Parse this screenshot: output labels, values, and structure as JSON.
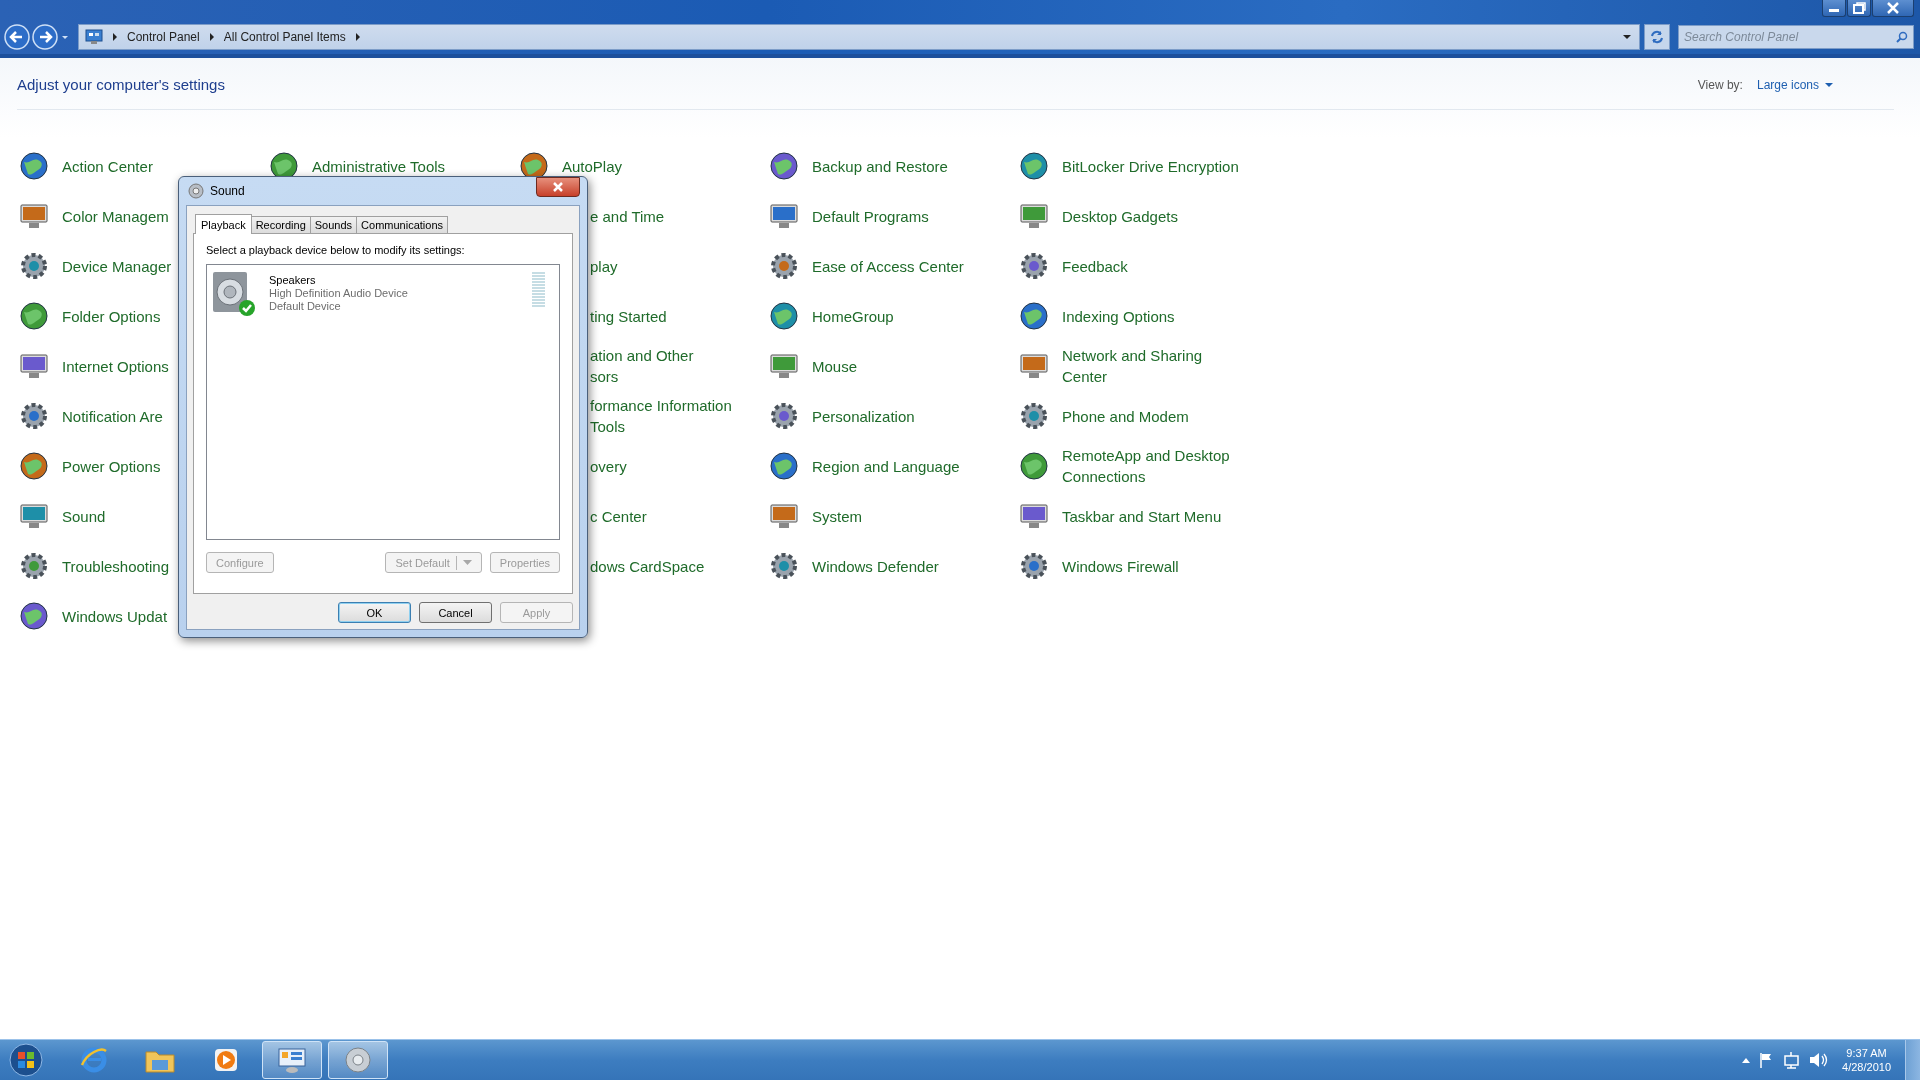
{
  "address_bar": {
    "breadcrumb": [
      "Control Panel",
      "All Control Panel Items"
    ],
    "search": {
      "placeholder": "Search Control Panel"
    }
  },
  "header": {
    "title": "Adjust your computer's settings",
    "view_by_label": "View by:",
    "view_by_value": "Large icons"
  },
  "columns": [
    [
      {
        "label": "Action Center"
      },
      {
        "label": "Color Managem"
      },
      {
        "label": "Device Manager"
      },
      {
        "label": "Folder Options"
      },
      {
        "label": "Internet Options"
      },
      {
        "label": "Notification Are"
      },
      {
        "label": "Power Options"
      },
      {
        "label": "Sound"
      },
      {
        "label": "Troubleshooting"
      },
      {
        "label": "Windows Updat"
      }
    ],
    [
      {
        "label": "Administrative Tools"
      }
    ],
    [
      {
        "label": "AutoPlay"
      }
    ],
    [
      {
        "label": "Backup and Restore"
      },
      {
        "label": "Default Programs"
      },
      {
        "label": "Ease of Access Center"
      },
      {
        "label": "HomeGroup"
      },
      {
        "label": "Mouse"
      },
      {
        "label": "Personalization"
      },
      {
        "label": "Region and Language"
      },
      {
        "label": "System"
      },
      {
        "label": "Windows Defender"
      }
    ],
    [
      {
        "label": "BitLocker Drive Encryption"
      },
      {
        "label": "Desktop Gadgets"
      },
      {
        "label": "Feedback"
      },
      {
        "label": "Indexing Options"
      },
      {
        "label": "Network and Sharing\nCenter"
      },
      {
        "label": "Phone and Modem"
      },
      {
        "label": "RemoteApp and Desktop\nConnections"
      },
      {
        "label": "Taskbar and Start Menu"
      },
      {
        "label": "Windows Firewall"
      }
    ]
  ],
  "partly_covered_items": [
    {
      "label": "e and Time"
    },
    {
      "label": "play"
    },
    {
      "label": "ting Started"
    },
    {
      "label": "ation and Other\nsors"
    },
    {
      "label": "formance Information\nTools"
    },
    {
      "label": "overy"
    },
    {
      "label": "c Center"
    },
    {
      "label": "dows CardSpace"
    }
  ],
  "dialog": {
    "title": "Sound",
    "tabs": [
      {
        "label": "Playback",
        "selected": true
      },
      {
        "label": "Recording",
        "selected": false
      },
      {
        "label": "Sounds",
        "selected": false
      },
      {
        "label": "Communications",
        "selected": false
      }
    ],
    "instruction": "Select a playback device below to modify its settings:",
    "devices": [
      {
        "name": "Speakers",
        "description": "High Definition Audio Device",
        "status": "Default Device",
        "default": true
      }
    ],
    "device_buttons": [
      {
        "label": "Configure",
        "disabled": true,
        "kind": "plain"
      },
      {
        "label": "Set Default",
        "disabled": true,
        "kind": "split"
      },
      {
        "label": "Properties",
        "disabled": true,
        "kind": "plain"
      }
    ],
    "footer_buttons": [
      {
        "label": "OK",
        "disabled": false,
        "default": true
      },
      {
        "label": "Cancel",
        "disabled": false,
        "default": false
      },
      {
        "label": "Apply",
        "disabled": true,
        "default": false
      }
    ]
  },
  "taskbar": {
    "apps": [
      {
        "kind": "browser",
        "active": false
      },
      {
        "kind": "folder",
        "active": false
      },
      {
        "kind": "media",
        "active": false
      },
      {
        "kind": "control-panel",
        "active": true
      },
      {
        "kind": "speaker",
        "active": true
      }
    ],
    "clock": {
      "time": "9:37 AM",
      "date": "4/28/2010"
    }
  }
}
